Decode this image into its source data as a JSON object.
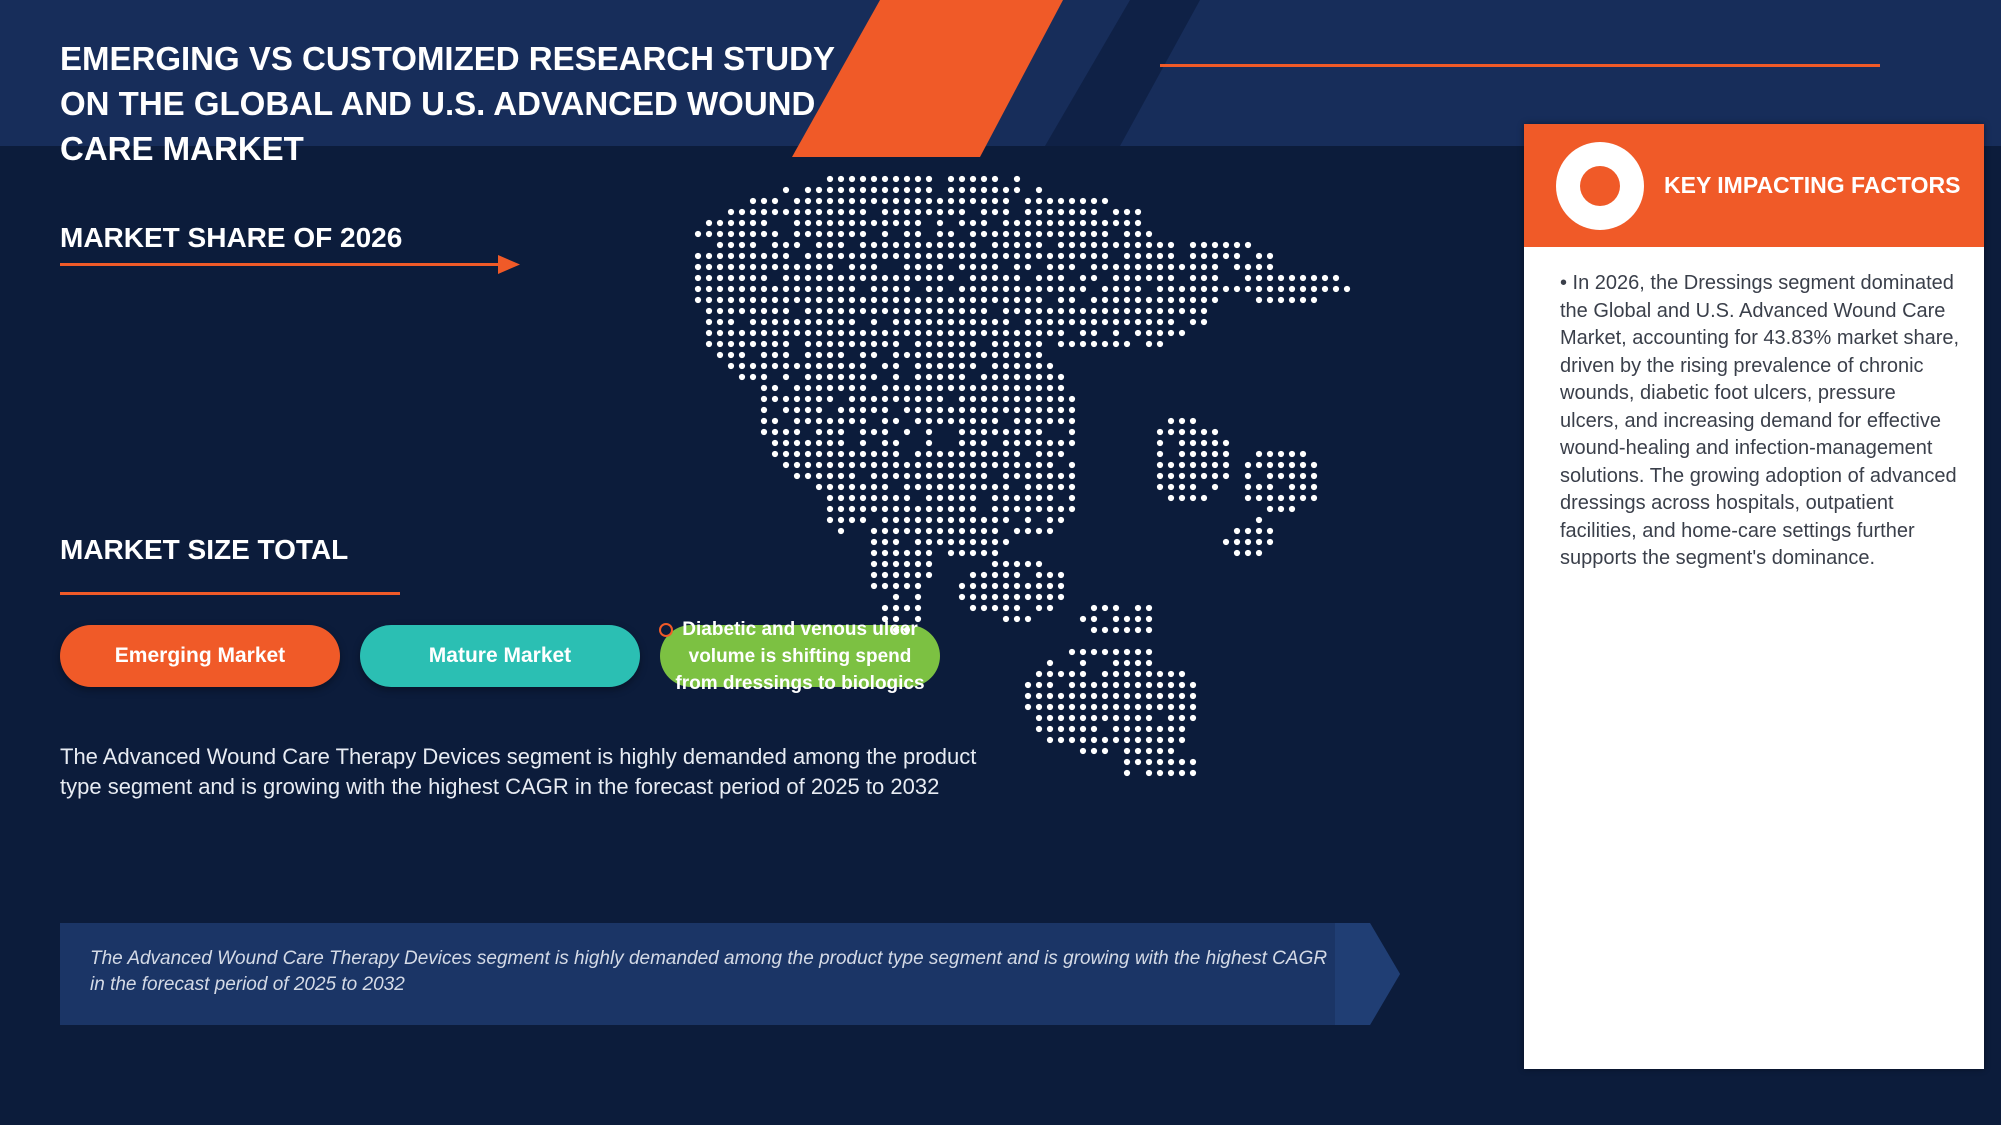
{
  "header": {
    "title": "EMERGING VS CUSTOMIZED RESEARCH STUDY ON THE GLOBAL AND U.S. ADVANCED WOUND CARE MARKET"
  },
  "sections": {
    "market_share": "MARKET SHARE OF 2026",
    "market_size": "MARKET SIZE TOTAL"
  },
  "buttons": {
    "emerging": "Emerging Market",
    "mature": "Mature Market",
    "insight": "Diabetic and venous ulcer volume is shifting spend from dressings to biologics"
  },
  "body_text": "The Advanced Wound Care Therapy Devices segment is highly demanded among the product type segment and is growing with the highest CAGR in the forecast period of 2025 to 2032",
  "banner_text": "The Advanced Wound Care Therapy Devices segment is highly demanded among the product type segment and is growing with the highest CAGR in the forecast period of 2025 to 2032",
  "key_factors": {
    "title": "KEY IMPACTING FACTORS",
    "body": "• In 2026, the Dressings segment dominated the Global and U.S. Advanced Wound Care Market, accounting for 43.83% market share, driven by the rising prevalence of chronic wounds, diabetic foot ulcers, pressure ulcers, and increasing demand for effective wound-healing and infection-management solutions. The growing adoption of advanced dressings across hospitals, outpatient facilities, and home-care settings further supports the segment's dominance."
  },
  "colors": {
    "background": "#0c1c3b",
    "top_band": "#172d5a",
    "accent_orange": "#f05a28",
    "teal": "#2bbfb3",
    "green": "#7cc142",
    "panel": "#ffffff"
  }
}
